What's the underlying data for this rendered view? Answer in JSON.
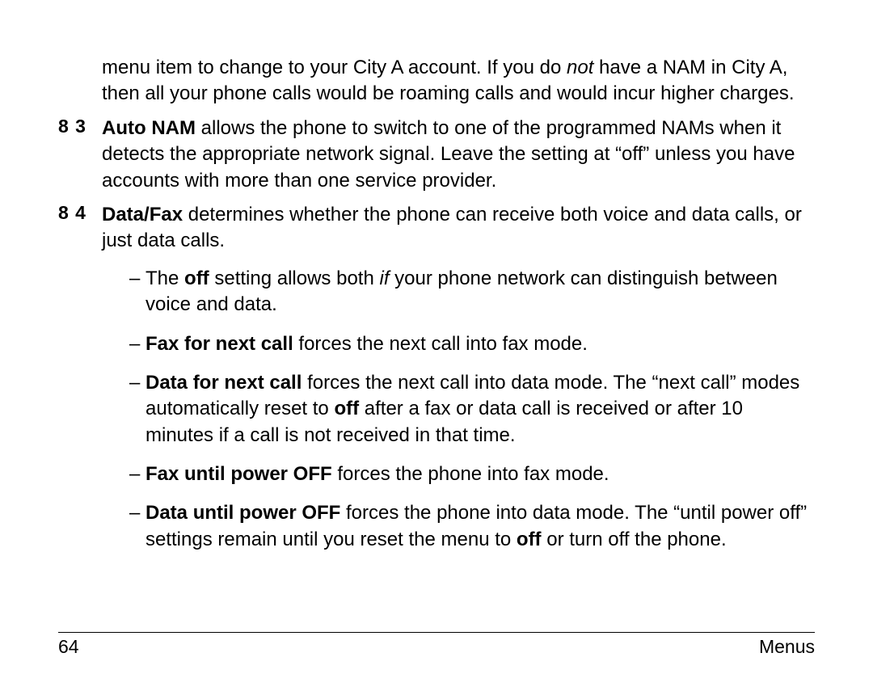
{
  "para0": {
    "t1": "menu item to change to your City A account. If you do ",
    "not": "not",
    "t2": " have a NAM in City A, then all your phone calls would be roaming calls and would incur higher charges."
  },
  "item83": {
    "num": "8 3",
    "label": "Auto NAM",
    "text": " allows the phone to switch to one of the programmed NAMs when it detects the appropriate network signal. Leave the setting at “off” unless you have accounts with more than one service provider."
  },
  "item84": {
    "num": "8 4",
    "label": "Data/Fax",
    "text": " determines whether the phone can receive both voice and data calls, or just data calls."
  },
  "sub": {
    "a": {
      "t1": "The ",
      "off": "off",
      "t2": " setting allows both ",
      "if": "if",
      "t3": " your phone network can distinguish between voice and data."
    },
    "b": {
      "label": "Fax for next call",
      "text": " forces the next call into fax mode."
    },
    "c": {
      "label": "Data for next call",
      "t1": " forces the next call into data mode. The “next call” modes automatically reset to ",
      "off": "off",
      "t2": " after a fax or data call is received or after 10 minutes if a call is not received in that time."
    },
    "d": {
      "label": "Fax until power OFF",
      "text": " forces the phone into fax mode."
    },
    "e": {
      "label": "Data until power OFF",
      "t1": " forces the phone into data mode. The “until power off” settings remain until you reset the menu to ",
      "off": "off",
      "t2": " or turn off the phone."
    }
  },
  "dash": "–",
  "footer": {
    "page": "64",
    "section": "Menus"
  }
}
